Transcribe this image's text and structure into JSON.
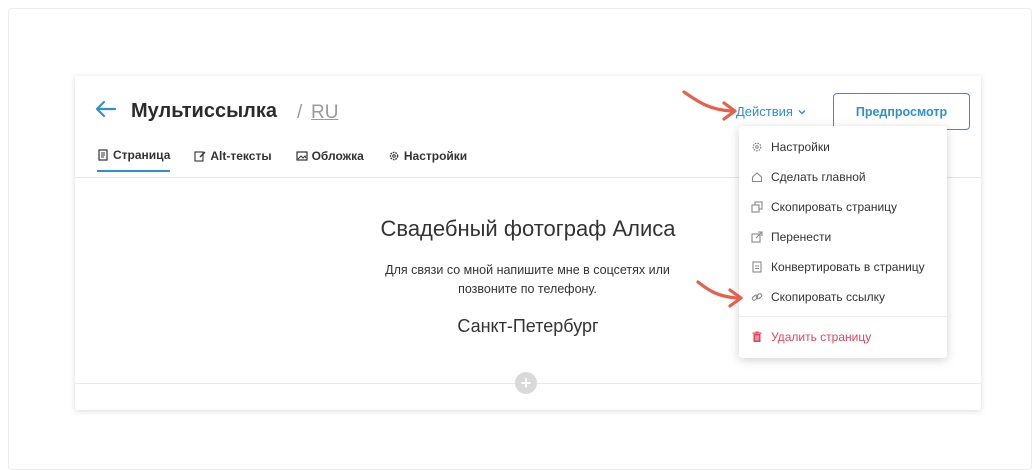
{
  "header": {
    "title": "Мультиссылка",
    "separator": "/",
    "language": "RU",
    "actions_label": "Действия",
    "preview_label": "Предпросмотр"
  },
  "tabs": [
    {
      "label": "Страница",
      "icon": "page-icon",
      "active": true
    },
    {
      "label": "Alt-тексты",
      "icon": "edit-icon",
      "active": false
    },
    {
      "label": "Обложка",
      "icon": "image-icon",
      "active": false
    },
    {
      "label": "Настройки",
      "icon": "gear-icon",
      "active": false
    }
  ],
  "content": {
    "title": "Свадебный фотограф Алиса",
    "description_line1": "Для связи со мной напишите мне в соцсетях или",
    "description_line2": "позвоните по телефону.",
    "city": "Санкт-Петербург"
  },
  "menu": {
    "items": [
      {
        "label": "Настройки",
        "icon": "gear-icon"
      },
      {
        "label": "Сделать главной",
        "icon": "home-icon"
      },
      {
        "label": "Скопировать страницу",
        "icon": "copy-icon"
      },
      {
        "label": "Перенести",
        "icon": "move-icon"
      },
      {
        "label": "Конвертировать в страницу",
        "icon": "document-icon"
      },
      {
        "label": "Скопировать ссылку",
        "icon": "link-icon"
      }
    ],
    "danger_item": {
      "label": "Удалить страницу",
      "icon": "trash-icon"
    }
  },
  "colors": {
    "accent": "#2e8fd4",
    "danger": "#e2445c",
    "annotation_arrow": "#e8604c"
  }
}
